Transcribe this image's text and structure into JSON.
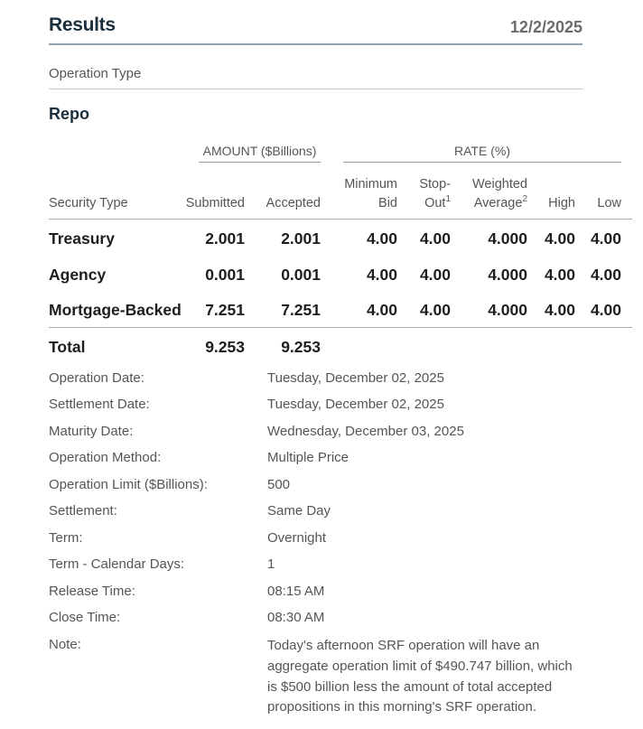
{
  "header": {
    "title": "Results",
    "date": "12/2/2025"
  },
  "operation": {
    "type_label": "Operation Type",
    "type_value": "Repo"
  },
  "table": {
    "group_amount": "AMOUNT ($Billions)",
    "group_rate": "RATE (%)",
    "columns": {
      "security_type": "Security Type",
      "submitted": "Submitted",
      "accepted": "Accepted",
      "minimum_l1": "Minimum",
      "minimum_l2": "Bid",
      "stop_l1": "Stop-",
      "stop_l2": "Out",
      "stop_sup": "1",
      "weighted_l1": "Weighted",
      "weighted_l2": "Average",
      "weighted_sup": "2",
      "high": "High",
      "low": "Low"
    },
    "rows": [
      {
        "security": "Treasury",
        "submitted": "2.001",
        "accepted": "2.001",
        "min_bid": "4.00",
        "stop_out": "4.00",
        "weighted_avg": "4.000",
        "high": "4.00",
        "low": "4.00"
      },
      {
        "security": "Agency",
        "submitted": "0.001",
        "accepted": "0.001",
        "min_bid": "4.00",
        "stop_out": "4.00",
        "weighted_avg": "4.000",
        "high": "4.00",
        "low": "4.00"
      },
      {
        "security": "Mortgage-Backed",
        "submitted": "7.251",
        "accepted": "7.251",
        "min_bid": "4.00",
        "stop_out": "4.00",
        "weighted_avg": "4.000",
        "high": "4.00",
        "low": "4.00"
      }
    ],
    "total": {
      "label": "Total",
      "submitted": "9.253",
      "accepted": "9.253"
    }
  },
  "details": [
    {
      "label": "Operation Date:",
      "value": "Tuesday, December 02, 2025"
    },
    {
      "label": "Settlement Date:",
      "value": "Tuesday, December 02, 2025"
    },
    {
      "label": "Maturity Date:",
      "value": "Wednesday, December 03, 2025"
    },
    {
      "label": "Operation Method:",
      "value": "Multiple Price"
    },
    {
      "label": "Operation Limit ($Billions):",
      "value": "500"
    },
    {
      "label": "Settlement:",
      "value": "Same Day"
    },
    {
      "label": "Term:",
      "value": "Overnight"
    },
    {
      "label": "Term - Calendar Days:",
      "value": "1"
    },
    {
      "label": "Release Time:",
      "value": "08:15 AM"
    },
    {
      "label": "Close Time:",
      "value": "08:30 AM"
    },
    {
      "label": "Note:",
      "value": "Today's afternoon SRF operation will have an aggregate operation limit of $490.747 billion, which is $500 billion less the amount of total accepted propositions in this morning's SRF operation."
    }
  ]
}
